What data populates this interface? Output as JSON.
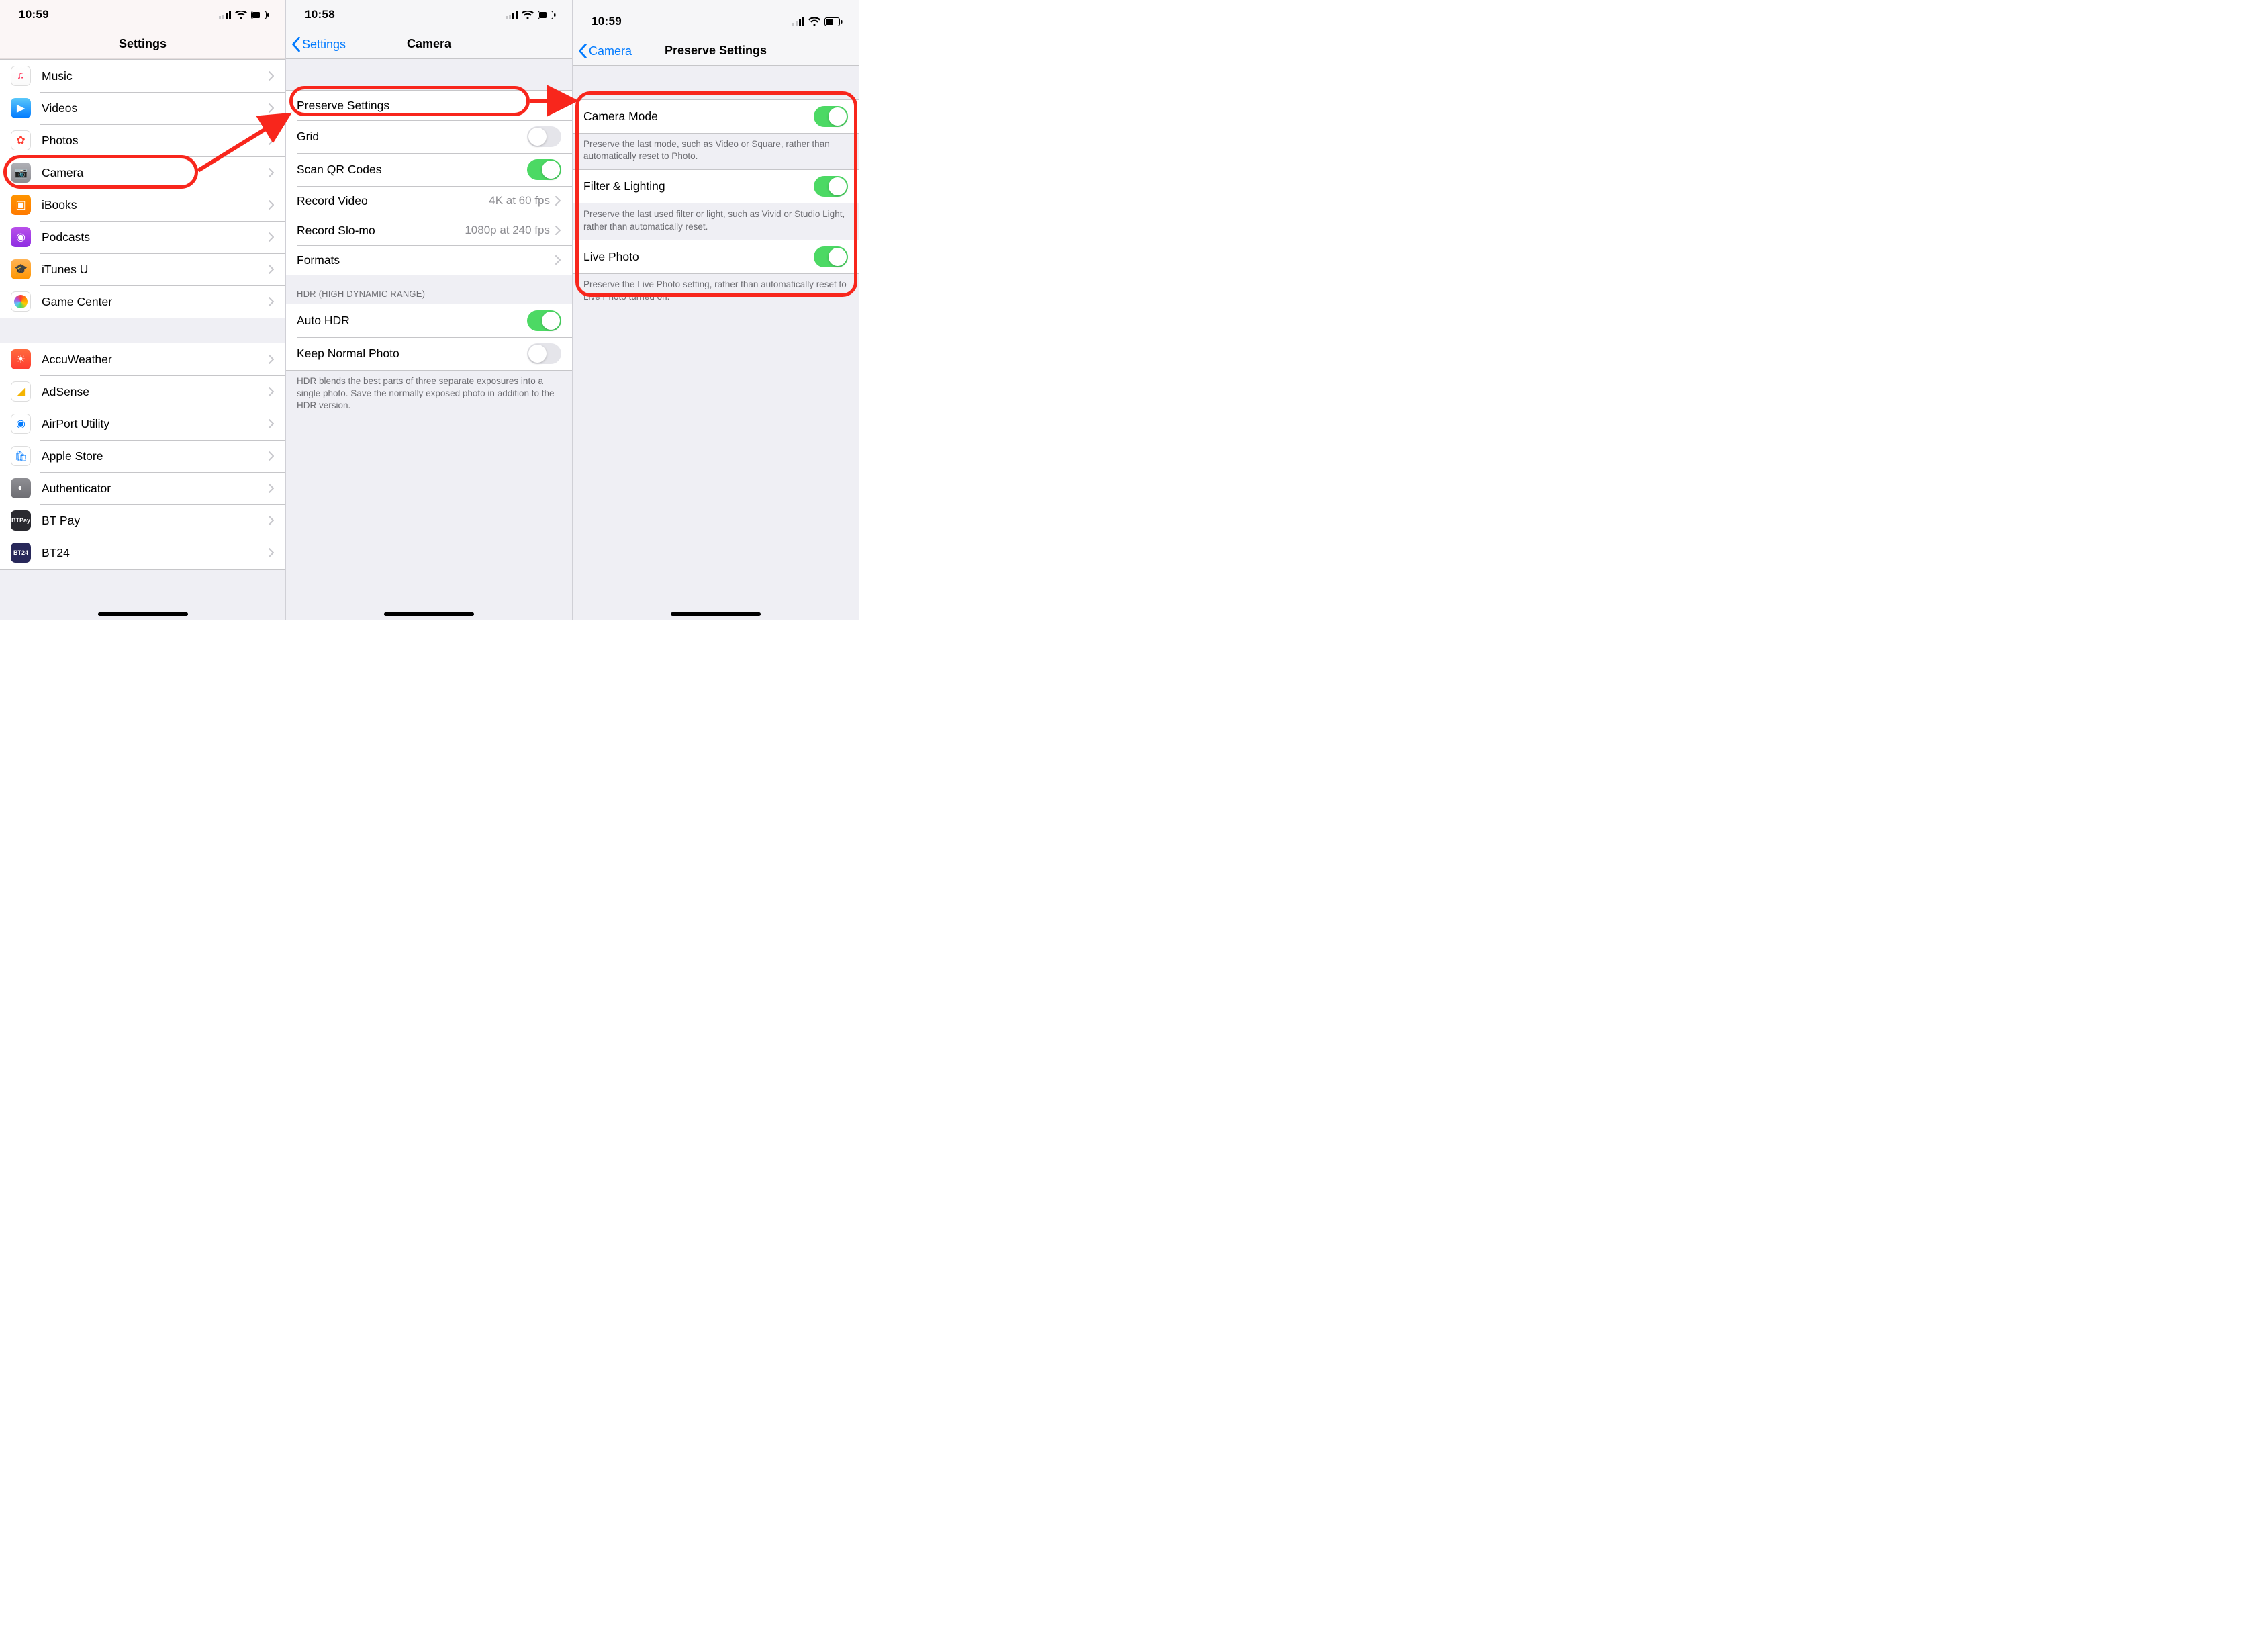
{
  "statusbar": {
    "time_1": "10:59",
    "time_2": "10:58",
    "time_3": "10:59"
  },
  "screen1": {
    "title": "Settings",
    "items_top": [
      {
        "name": "music",
        "label": "Music",
        "icon_class": "ic-music",
        "glyph": "♫"
      },
      {
        "name": "videos",
        "label": "Videos",
        "icon_class": "ic-videos",
        "glyph": "▶"
      },
      {
        "name": "photos",
        "label": "Photos",
        "icon_class": "ic-photos",
        "glyph": "✿"
      },
      {
        "name": "camera",
        "label": "Camera",
        "icon_class": "ic-camera",
        "glyph": "📷"
      },
      {
        "name": "ibooks",
        "label": "iBooks",
        "icon_class": "ic-ibooks",
        "glyph": "▣"
      },
      {
        "name": "podcasts",
        "label": "Podcasts",
        "icon_class": "ic-podcasts",
        "glyph": "◉"
      },
      {
        "name": "itunesu",
        "label": "iTunes U",
        "icon_class": "ic-itunesu",
        "glyph": "🎓"
      },
      {
        "name": "gamecenter",
        "label": "Game Center",
        "icon_class": "ic-gc",
        "glyph": "●"
      }
    ],
    "items_apps": [
      {
        "name": "accuweather",
        "label": "AccuWeather",
        "icon_class": "ic-accu",
        "glyph": "☀"
      },
      {
        "name": "adsense",
        "label": "AdSense",
        "icon_class": "ic-adsense",
        "glyph": "◢"
      },
      {
        "name": "airport",
        "label": "AirPort Utility",
        "icon_class": "ic-airport",
        "glyph": ""
      },
      {
        "name": "applestore",
        "label": "Apple Store",
        "icon_class": "ic-apstore",
        "glyph": ""
      },
      {
        "name": "authenticator",
        "label": "Authenticator",
        "icon_class": "ic-auth",
        "glyph": "◐"
      },
      {
        "name": "btpay",
        "label": "BT Pay",
        "icon_class": "ic-btpay",
        "glyph": "BTPay"
      },
      {
        "name": "bt24",
        "label": "BT24",
        "icon_class": "ic-bt24",
        "glyph": "BT24"
      }
    ]
  },
  "screen2": {
    "back_label": "Settings",
    "title": "Camera",
    "rows": {
      "preserve": {
        "label": "Preserve Settings",
        "type": "nav"
      },
      "grid": {
        "label": "Grid",
        "type": "switch",
        "on": false
      },
      "qr": {
        "label": "Scan QR Codes",
        "type": "switch",
        "on": true
      },
      "recvideo": {
        "label": "Record Video",
        "type": "nav",
        "detail": "4K at 60 fps"
      },
      "recslomo": {
        "label": "Record Slo-mo",
        "type": "nav",
        "detail": "1080p at 240 fps"
      },
      "formats": {
        "label": "Formats",
        "type": "nav"
      }
    },
    "hdr_header": "HDR (HIGH DYNAMIC RANGE)",
    "hdr_rows": {
      "auto": {
        "label": "Auto HDR",
        "type": "switch",
        "on": true
      },
      "keep": {
        "label": "Keep Normal Photo",
        "type": "switch",
        "on": false
      }
    },
    "hdr_footer": "HDR blends the best parts of three separate exposures into a single photo. Save the normally exposed photo in addition to the HDR version."
  },
  "screen3": {
    "back_label": "Camera",
    "title": "Preserve Settings",
    "rows": {
      "mode": {
        "label": "Camera Mode",
        "on": true,
        "footer": "Preserve the last mode, such as Video or Square, rather than automatically reset to Photo."
      },
      "filter": {
        "label": "Filter & Lighting",
        "on": true,
        "footer": "Preserve the last used filter or light, such as Vivid or Studio Light, rather than automatically reset."
      },
      "live": {
        "label": "Live Photo",
        "on": true,
        "footer": "Preserve the Live Photo setting, rather than automatically reset to Live Photo turned on."
      }
    }
  }
}
